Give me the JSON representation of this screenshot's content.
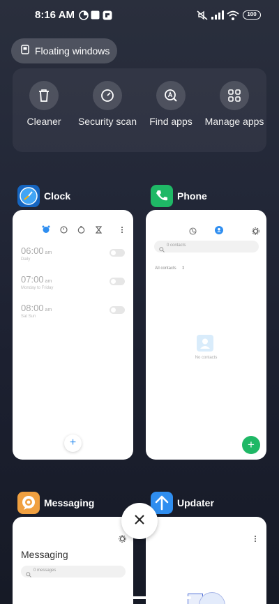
{
  "status_bar": {
    "time": "8:16 AM",
    "battery": "100"
  },
  "floating_windows": {
    "label": "Floating windows",
    "icon": "floating-window-icon"
  },
  "quick_actions": [
    {
      "label": "Cleaner",
      "icon": "trash-icon"
    },
    {
      "label": "Security scan",
      "icon": "security-scan-icon"
    },
    {
      "label": "Find apps",
      "icon": "find-apps-icon"
    },
    {
      "label": "Manage apps",
      "icon": "grid-icon"
    }
  ],
  "apps": {
    "clock": {
      "name": "Clock",
      "alarms": [
        {
          "time": "06:00",
          "ampm": "am",
          "repeat": "Daily"
        },
        {
          "time": "07:00",
          "ampm": "am",
          "repeat": "Monday to Friday"
        },
        {
          "time": "08:00",
          "ampm": "am",
          "repeat": "Sat Sun"
        }
      ],
      "add_label": "+"
    },
    "phone": {
      "name": "Phone",
      "search_placeholder": "0 contacts",
      "filter_label": "All contacts",
      "empty_text": "No contacts",
      "add_label": "+"
    },
    "messaging": {
      "name": "Messaging",
      "title": "Messaging",
      "search_placeholder": "0 messages"
    },
    "updater": {
      "name": "Updater"
    }
  },
  "colors": {
    "accent_blue": "#2f8ef0",
    "phone_green": "#1fb866",
    "clock_icon_bg": "#1565c0",
    "messaging_icon_bg": "#f0a040",
    "updater_icon_bg": "#2f8ef0"
  }
}
